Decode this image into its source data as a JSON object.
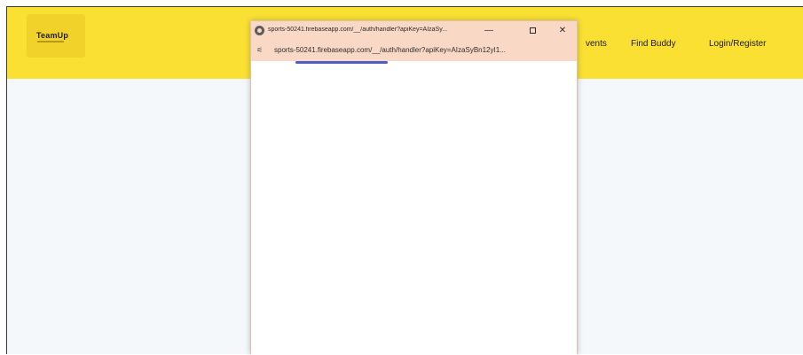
{
  "site": {
    "logo_text": "TeamUp",
    "nav": {
      "events_label": "vents",
      "find_buddy_label": "Find Buddy",
      "login_label": "Login/Register"
    }
  },
  "popup": {
    "title": "sports-50241.firebaseapp.com/__/auth/handler?apiKey=AIzaSy...",
    "url": "sports-50241.firebaseapp.com/__/auth/handler?apiKey=AIzaSyBn12yI1...",
    "buttons": {
      "minimize": "—",
      "close": "✕"
    },
    "loading_progress": 0.5
  },
  "colors": {
    "navbar": "#fbe034",
    "page_background": "#f5f8fb",
    "popup_titlebar": "#f9d9c6",
    "progress": "#4a5fc1"
  }
}
